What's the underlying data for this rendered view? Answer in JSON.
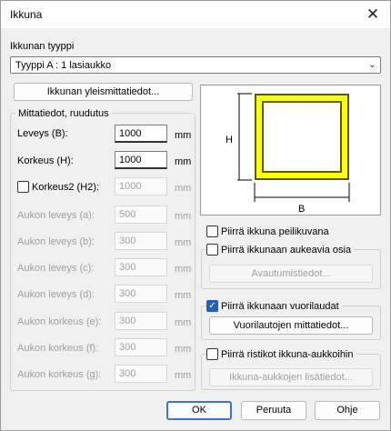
{
  "window": {
    "title": "Ikkuna",
    "close_glyph": "✕"
  },
  "type_section": {
    "label": "Ikkunan tyyppi",
    "selected": "Tyyppi A : 1 lasiaukko",
    "chevron": "⌄"
  },
  "general_button": "Ikkunan yleismittatiedot...",
  "dimensions_group": {
    "title": "Mittatiedot, ruudutus",
    "unit": "mm",
    "rows": [
      {
        "label": "Leveys (B):",
        "value": "1000",
        "enabled": true
      },
      {
        "label": "Korkeus (H):",
        "value": "1000",
        "enabled": true
      },
      {
        "label": "Korkeus2 (H2):",
        "value": "1000",
        "enabled": false,
        "checkbox": true,
        "checked": false
      },
      {
        "label": "Aukon leveys (a):",
        "value": "500",
        "enabled": false
      },
      {
        "label": "Aukon leveys (b):",
        "value": "300",
        "enabled": false
      },
      {
        "label": "Aukon leveys (c):",
        "value": "300",
        "enabled": false
      },
      {
        "label": "Aukon leveys (d):",
        "value": "300",
        "enabled": false
      },
      {
        "label": "Aukon korkeus (e):",
        "value": "300",
        "enabled": false
      },
      {
        "label": "Aukon korkeus (f):",
        "value": "300",
        "enabled": false
      },
      {
        "label": "Aukon korkeus (g):",
        "value": "300",
        "enabled": false
      }
    ]
  },
  "preview": {
    "h_label": "H",
    "b_label": "B"
  },
  "options": {
    "mirror": {
      "label": "Piirrä ikkuna peilikuvana",
      "checked": false
    },
    "opening_parts": {
      "label": "Piirrä ikkunaan aukeavia osia",
      "checked": false,
      "button": "Avautumistiedot...",
      "button_enabled": false
    },
    "sills": {
      "label": "Piirrä ikkunaan vuorilaudat",
      "checked": true,
      "button": "Vuorilautojen mittatiedot...",
      "button_enabled": true
    },
    "grid": {
      "label": "Piirrä ristikot ikkuna-aukkoihin",
      "checked": false,
      "button": "Ikkuna-aukkojen lisätiedot...",
      "button_enabled": false
    }
  },
  "footer": {
    "ok": "OK",
    "cancel": "Peruuta",
    "help": "Ohje"
  },
  "colors": {
    "accent": "#1f63c0",
    "frame_yellow": "#ffff00",
    "frame_dark": "#5a5a00"
  }
}
